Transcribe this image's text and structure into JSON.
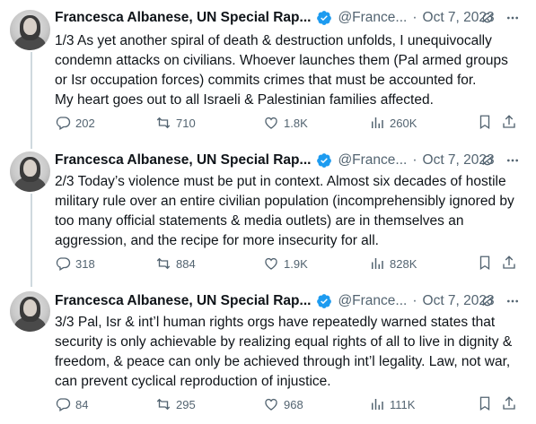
{
  "tweets": [
    {
      "author": "Francesca Albanese, UN Special Rap...",
      "handle": "@France...",
      "separator": "·",
      "date": "Oct 7, 2023",
      "text": "1/3 As yet another spiral of death & destruction unfolds, I unequivocally\ncondemn attacks on civilians. Whoever launches them (Pal armed groups\nor Isr occupation forces) commits crimes that must be accounted for.\nMy heart goes out to all Israeli & Palestinian families affected.",
      "replies": "202",
      "reposts": "710",
      "likes": "1.8K",
      "views": "260K"
    },
    {
      "author": "Francesca Albanese, UN Special Rap...",
      "handle": "@France...",
      "separator": "·",
      "date": "Oct 7, 2023",
      "text": "2/3 Today’s violence must be put in context. Almost six decades of hostile\nmilitary rule over an entire civilian population (incomprehensibly ignored by\ntoo many official statements & media outlets) are in themselves an\naggression, and the recipe for more insecurity for all.",
      "replies": "318",
      "reposts": "884",
      "likes": "1.9K",
      "views": "828K"
    },
    {
      "author": "Francesca Albanese, UN Special Rap...",
      "handle": "@France...",
      "separator": "·",
      "date": "Oct 7, 2023",
      "text": "3/3 Pal, Isr & int’l human rights orgs have repeatedly warned states that\nsecurity is only achievable by realizing equal rights of all to live in dignity &\nfreedom, & peace can only be achieved through int’l legality. Law, not war,\ncan prevent cyclical reproduction of injustice.",
      "replies": "84",
      "reposts": "295",
      "likes": "968",
      "views": "111K"
    }
  ],
  "colors": {
    "verified": "#1d9bf0",
    "muted": "#536471",
    "text": "#0f1419",
    "thread_line": "#cfd9de"
  },
  "icons": [
    "verified-badge-icon",
    "grok-icon",
    "more-icon",
    "reply-icon",
    "repost-icon",
    "like-icon",
    "views-icon",
    "bookmark-icon",
    "share-icon"
  ]
}
